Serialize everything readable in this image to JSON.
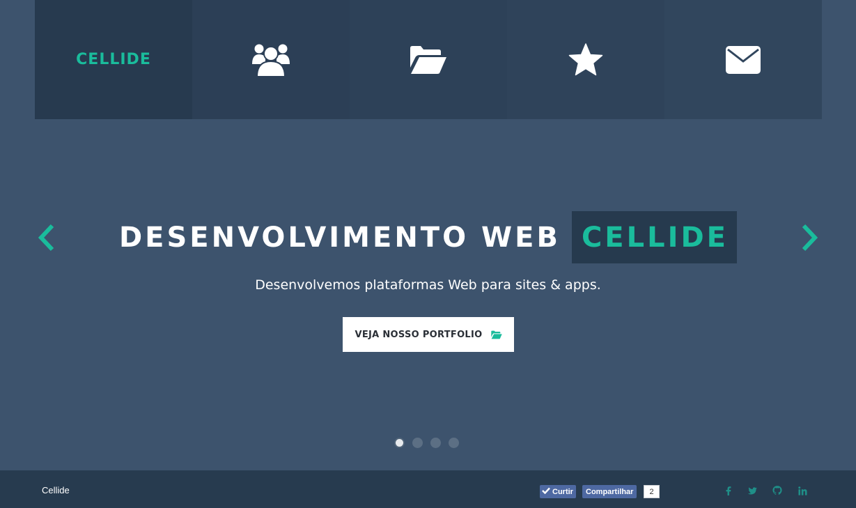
{
  "nav": {
    "brand": "CELLIDE",
    "items": [
      {
        "icon": "users-icon"
      },
      {
        "icon": "folder-open-icon"
      },
      {
        "icon": "star-icon"
      },
      {
        "icon": "envelope-icon"
      }
    ]
  },
  "hero": {
    "headline_main": "DESENVOLVIMENTO WEB",
    "headline_accent": "CELLIDE",
    "subtitle": "Desenvolvemos plataformas Web para sites & apps.",
    "cta_label": "VEJA NOSSO PORTFOLIO",
    "cta_icon": "folder-open-icon",
    "prev_icon": "chevron-left-icon",
    "next_icon": "chevron-right-icon",
    "slides_total": 4,
    "active_slide": 1
  },
  "footer": {
    "brand": "Cellide",
    "like_label": "Curtir",
    "share_label": "Compartilhar",
    "share_count": "2",
    "social": [
      "facebook-icon",
      "twitter-icon",
      "github-icon",
      "linkedin-icon"
    ]
  },
  "colors": {
    "accent": "#1abc9c",
    "background": "#3d536d",
    "nav_background": "#2f4259",
    "footer_background": "#273b4f",
    "facebook": "#4e69a2"
  }
}
